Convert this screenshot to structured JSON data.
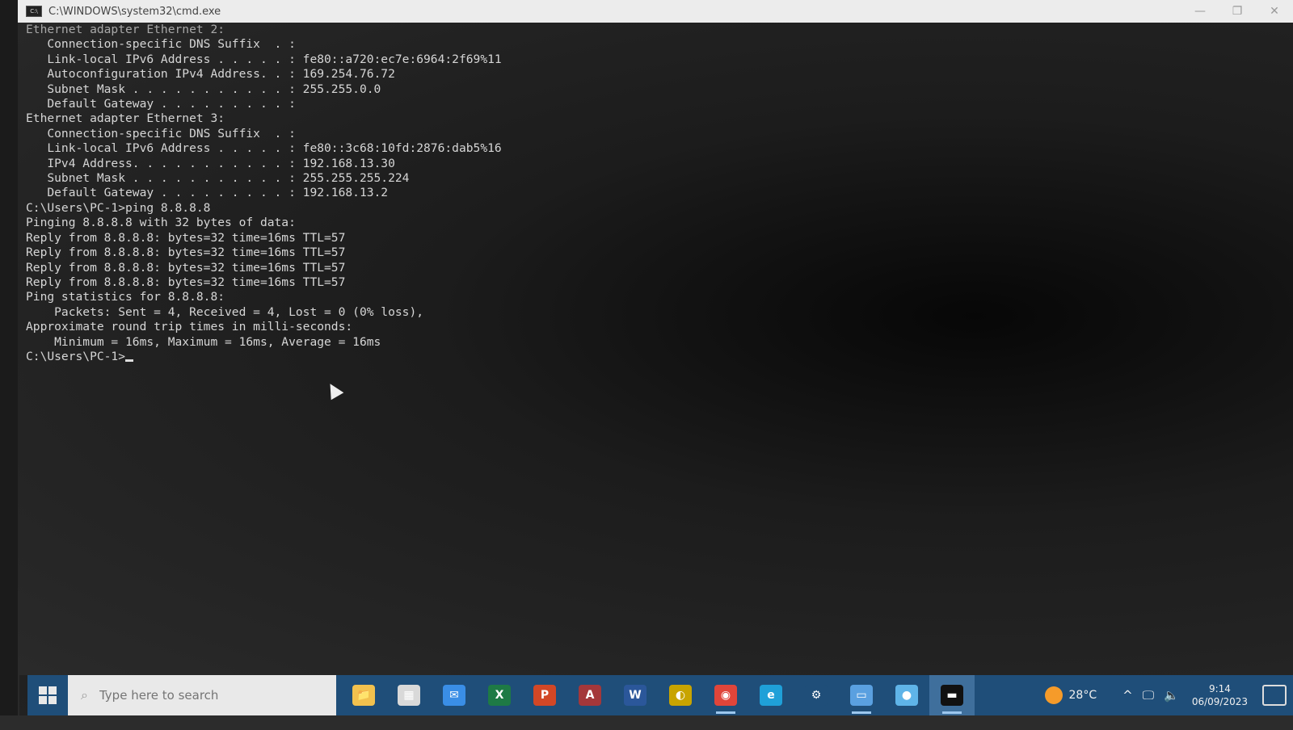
{
  "window": {
    "title": "C:\\WINDOWS\\system32\\cmd.exe",
    "icon_label": "C:\\",
    "minimize": "—",
    "maximize": "❐",
    "close": "✕"
  },
  "console": {
    "lines": [
      "Ethernet adapter Ethernet 2:",
      "",
      "   Connection-specific DNS Suffix  . :",
      "   Link-local IPv6 Address . . . . . : fe80::a720:ec7e:6964:2f69%11",
      "   Autoconfiguration IPv4 Address. . : 169.254.76.72",
      "   Subnet Mask . . . . . . . . . . . : 255.255.0.0",
      "   Default Gateway . . . . . . . . . :",
      "",
      "Ethernet adapter Ethernet 3:",
      "",
      "   Connection-specific DNS Suffix  . :",
      "   Link-local IPv6 Address . . . . . : fe80::3c68:10fd:2876:dab5%16",
      "   IPv4 Address. . . . . . . . . . . : 192.168.13.30",
      "   Subnet Mask . . . . . . . . . . . : 255.255.255.224",
      "   Default Gateway . . . . . . . . . : 192.168.13.2",
      "",
      "C:\\Users\\PC-1>ping 8.8.8.8",
      "",
      "Pinging 8.8.8.8 with 32 bytes of data:",
      "Reply from 8.8.8.8: bytes=32 time=16ms TTL=57",
      "Reply from 8.8.8.8: bytes=32 time=16ms TTL=57",
      "Reply from 8.8.8.8: bytes=32 time=16ms TTL=57",
      "Reply from 8.8.8.8: bytes=32 time=16ms TTL=57",
      "",
      "Ping statistics for 8.8.8.8:",
      "    Packets: Sent = 4, Received = 4, Lost = 0 (0% loss),",
      "Approximate round trip times in milli-seconds:",
      "    Minimum = 16ms, Maximum = 16ms, Average = 16ms",
      ""
    ],
    "prompt": "C:\\Users\\PC-1>"
  },
  "taskbar": {
    "search_placeholder": "Type here to search",
    "apps": [
      {
        "name": "file-explorer",
        "icon": "📁",
        "color": "#f2c14e",
        "running": false,
        "active": false
      },
      {
        "name": "store",
        "icon": "▦",
        "color": "#d9d9d9",
        "running": false,
        "active": false
      },
      {
        "name": "mail",
        "icon": "✉",
        "color": "#3a8ee6",
        "running": false,
        "active": false
      },
      {
        "name": "excel",
        "icon": "X",
        "color": "#1e7a45",
        "running": false,
        "active": false
      },
      {
        "name": "powerpoint",
        "icon": "P",
        "color": "#d24726",
        "running": false,
        "active": false
      },
      {
        "name": "access",
        "icon": "A",
        "color": "#a4373a",
        "running": false,
        "active": false
      },
      {
        "name": "word",
        "icon": "W",
        "color": "#2b579a",
        "running": false,
        "active": false
      },
      {
        "name": "media-app",
        "icon": "◐",
        "color": "#c8a400",
        "running": false,
        "active": false
      },
      {
        "name": "chrome",
        "icon": "◉",
        "color": "#e0453a",
        "running": true,
        "active": false
      },
      {
        "name": "edge",
        "icon": "e",
        "color": "#1fa0d8",
        "running": false,
        "active": false
      },
      {
        "name": "settings",
        "icon": "⚙",
        "color": "#1f4e79",
        "running": false,
        "active": false
      },
      {
        "name": "remote-desktop",
        "icon": "▭",
        "color": "#5aa0e0",
        "running": true,
        "active": false
      },
      {
        "name": "browser",
        "icon": "●",
        "color": "#5fb4e8",
        "running": false,
        "active": false
      },
      {
        "name": "cmd",
        "icon": "▬",
        "color": "#111111",
        "running": true,
        "active": true
      }
    ],
    "weather": "28°C",
    "tray_chevron": "^",
    "network_icon": "🖵",
    "volume_icon": "🔈",
    "time": "9:14",
    "date": "06/09/2023"
  }
}
